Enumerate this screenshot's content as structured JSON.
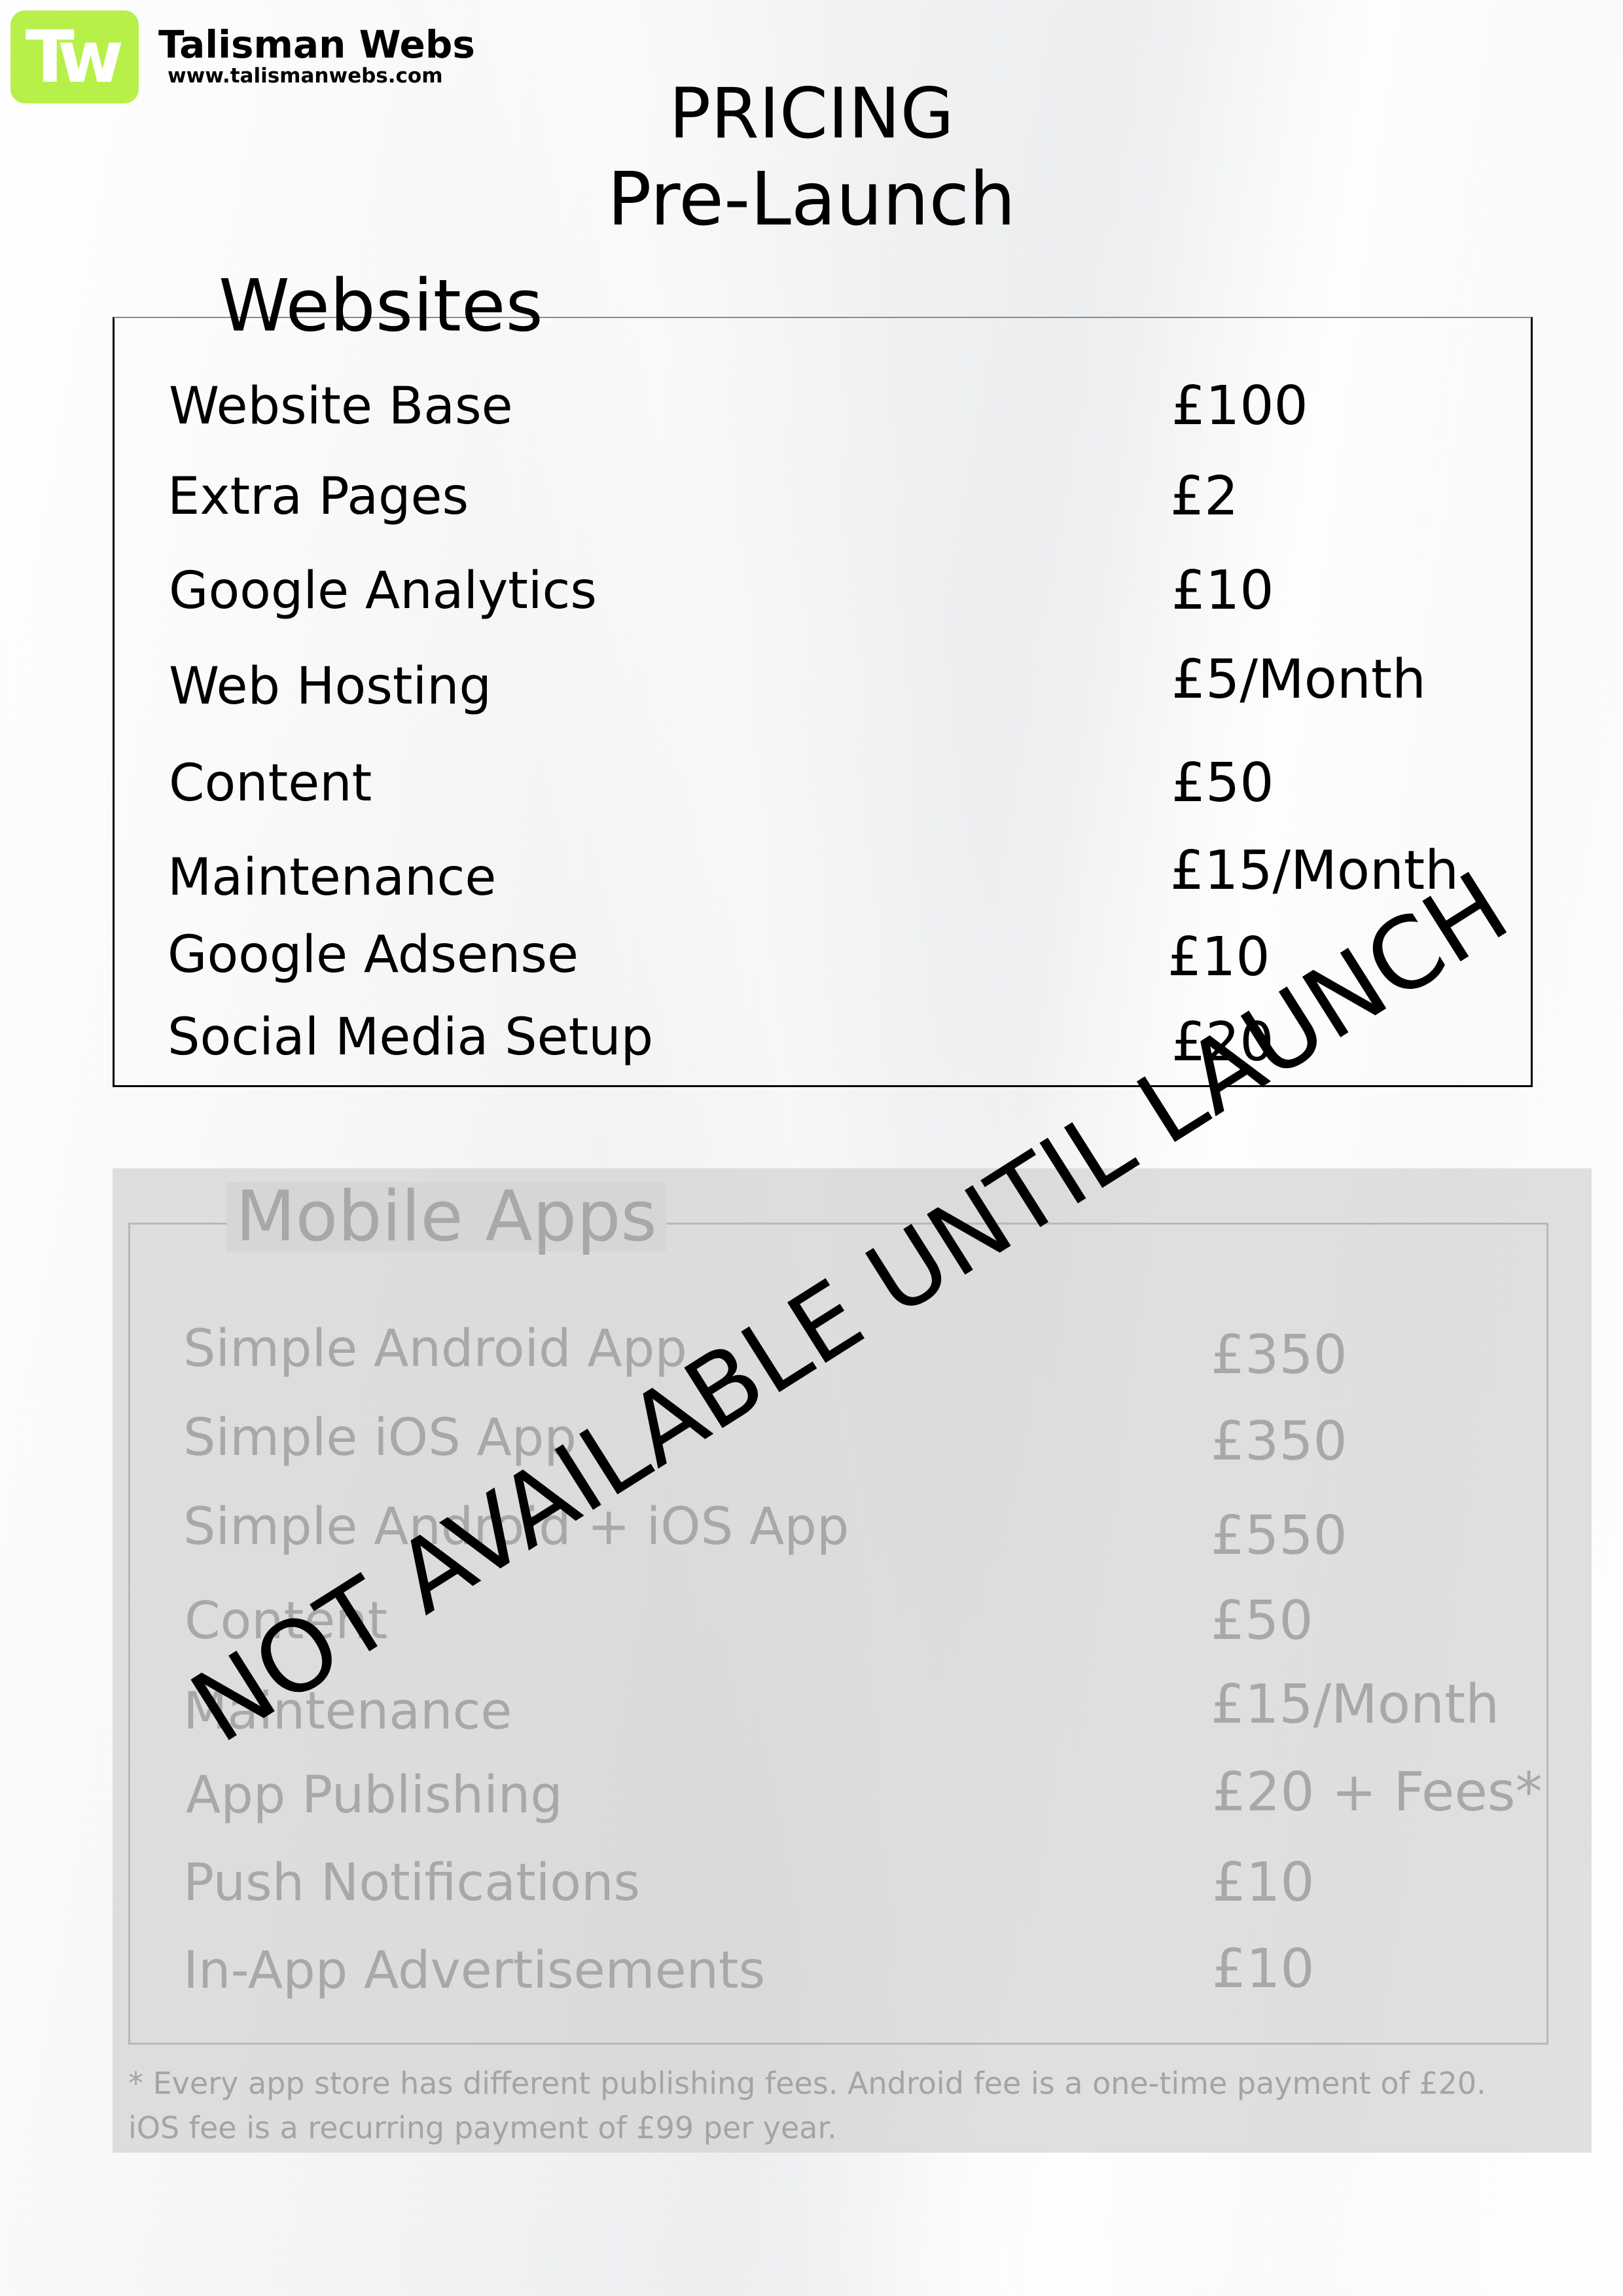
{
  "brand": {
    "logo_text": "Tw",
    "name": "Talisman Webs",
    "url": "www.talismanwebs.com",
    "accent_color": "#b8f04a"
  },
  "header": {
    "title": "PRICING",
    "subtitle": "Pre-Launch"
  },
  "websites": {
    "heading": "Websites",
    "items": [
      {
        "label": "Website Base",
        "price": "£100"
      },
      {
        "label": "Extra Pages",
        "price": "£2"
      },
      {
        "label": "Google Analytics",
        "price": "£10"
      },
      {
        "label": "Web Hosting",
        "price": "£5/Month"
      },
      {
        "label": "Content",
        "price": "£50"
      },
      {
        "label": "Maintenance",
        "price": "£15/Month"
      },
      {
        "label": "Google Adsense",
        "price": "£10"
      },
      {
        "label": "Social Media Setup",
        "price": "£20"
      }
    ]
  },
  "mobile_apps": {
    "heading": "Mobile Apps",
    "items": [
      {
        "label": "Simple Android App",
        "price": "£350"
      },
      {
        "label": "Simple iOS App",
        "price": "£350"
      },
      {
        "label": "Simple Android + iOS App",
        "price": "£550"
      },
      {
        "label": "Content",
        "price": "£50"
      },
      {
        "label": "Maintenance",
        "price": "£15/Month"
      },
      {
        "label": "App Publishing",
        "price": "£20 + Fees*"
      },
      {
        "label": "Push Notifications",
        "price": "£10"
      },
      {
        "label": "In-App Advertisements",
        "price": "£10"
      }
    ],
    "footnote_line1": "* Every app store has different publishing fees. Android fee is a one-time payment of £20.",
    "footnote_line2": "iOS fee is a recurring payment of £99 per year.",
    "overlay": "NOT AVAILABLE UNTIL LAUNCH"
  }
}
